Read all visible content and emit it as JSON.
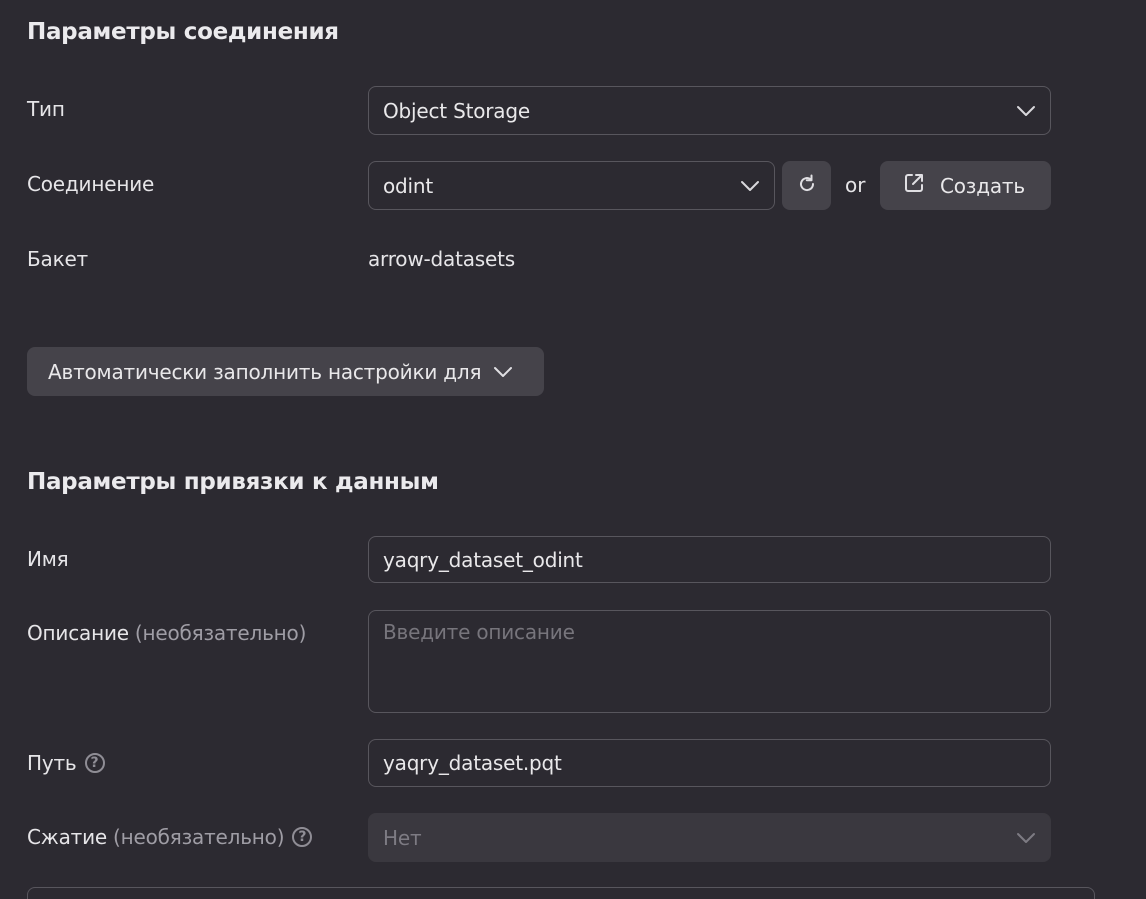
{
  "connection_section": {
    "title": "Параметры соединения",
    "type_label": "Тип",
    "type_value": "Object Storage",
    "connection_label": "Соединение",
    "connection_value": "odint",
    "or_text": "or",
    "create_label": "Создать",
    "bucket_label": "Бакет",
    "bucket_value": "arrow-datasets"
  },
  "autofill": {
    "label": "Автоматически заполнить настройки для"
  },
  "binding_section": {
    "title": "Параметры привязки к данным",
    "name_label": "Имя",
    "name_value": "yaqry_dataset_odint",
    "description_label": "Описание",
    "description_optional": "(необязательно)",
    "description_placeholder": "Введите описание",
    "path_label": "Путь",
    "path_value": "yaqry_dataset.pqt",
    "compression_label": "Сжатие",
    "compression_optional": "(необязательно)",
    "compression_value": "Нет"
  },
  "icons": {
    "chevron": "chevron-down-icon",
    "refresh": "refresh-icon",
    "external": "external-link-icon",
    "help": "help-icon"
  },
  "colors": {
    "background": "#2c2a31",
    "button": "#45434a",
    "border": "#58565d"
  }
}
